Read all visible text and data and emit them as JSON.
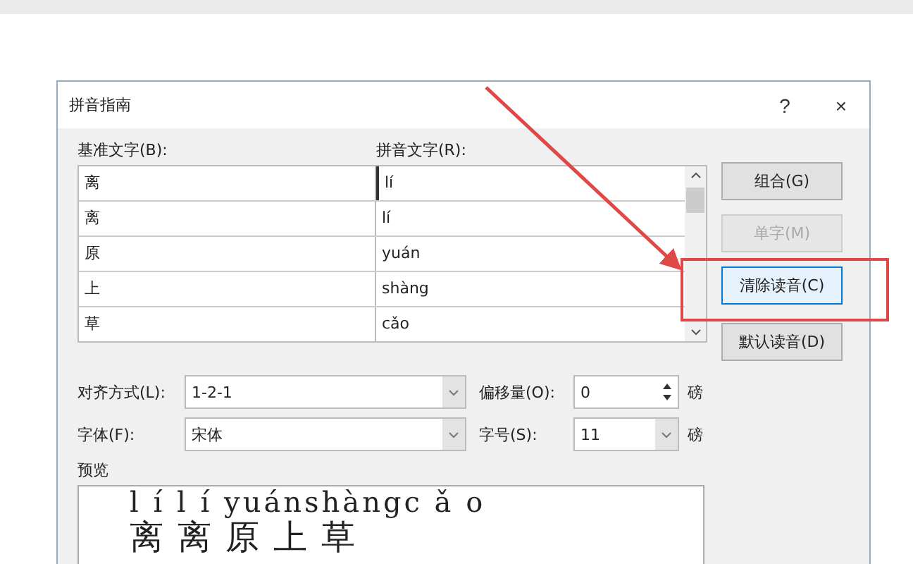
{
  "dialog": {
    "title": "拼音指南",
    "help": "?",
    "close": "×"
  },
  "table": {
    "columns": [
      "基准文字(B):",
      "拼音文字(R):"
    ],
    "rows": [
      {
        "base": "离",
        "ruby": "lí",
        "selected": true
      },
      {
        "base": "离",
        "ruby": "lí",
        "selected": false
      },
      {
        "base": "原",
        "ruby": "yuán",
        "selected": false
      },
      {
        "base": "上",
        "ruby": "shàng",
        "selected": false
      },
      {
        "base": "草",
        "ruby": "cǎo",
        "selected": false
      }
    ]
  },
  "buttons": [
    {
      "label": "组合(G)",
      "disabled": false,
      "focused": false
    },
    {
      "label": "单字(M)",
      "disabled": true,
      "focused": false
    },
    {
      "label": "清除读音(C)",
      "disabled": false,
      "focused": true
    },
    {
      "label": "默认读音(D)",
      "disabled": false,
      "focused": false
    }
  ],
  "options": [
    {
      "label": "对齐方式(L):",
      "value": "1-2-1",
      "kind": "dropdown"
    },
    {
      "label": "偏移量(O):",
      "value": "0",
      "kind": "spinner",
      "unit": "磅"
    },
    {
      "label": "字体(F):",
      "value": "宋体",
      "kind": "dropdown"
    },
    {
      "label": "字号(S):",
      "value": "11",
      "kind": "dropdown",
      "unit": "磅"
    }
  ],
  "preview": {
    "label": "预览",
    "ruby_line": "l í l í yuánshàngc ǎ o",
    "base_line": "离离原上草"
  }
}
